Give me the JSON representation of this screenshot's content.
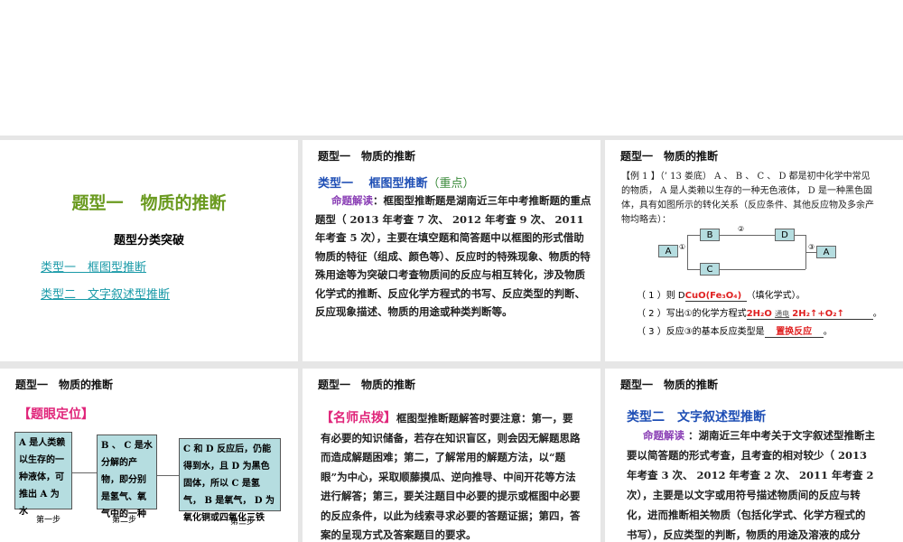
{
  "header": "题型一　物质的推断",
  "slide1": {
    "title": "题型一　物质的推断",
    "subtitle": "题型分类突破",
    "links": [
      "类型一　框图型推断",
      "类型二　文字叙述型推断"
    ]
  },
  "slide2": {
    "type_label": "类型一　 框图型推断",
    "emphasis": "（重点）",
    "lead": "命题解读",
    "text": "：框图型推断题是湖南近三年中考推断题的重点题型（ 2013 年考查 7 次、 2012 年考查 9 次、 2011 年考查 5 次），主要在填空题和简答题中以框图的形式借助物质的特征（组成、颜色等）、反应时的特殊现象、物质的特殊用途等为突破口考查物质间的反应与相互转化，涉及物质化学式的推断、反应化学方程式的书写、反应类型的判断、反应现象描述、物质的用途或种类判断等。"
  },
  "slide3": {
    "example": "【例 1 】（’ 13 娄底） A 、 B 、 C 、 D 都是初中化学中常见的物质， A 是人类赖以生存的一种无色液体， D 是一种黑色固体，具有如图所示的转化关系（反应条件、其他反应物及多余产物均略去）：",
    "nodes": [
      "A",
      "B",
      "C",
      "D",
      "A"
    ],
    "marks": [
      "①",
      "②",
      "③"
    ],
    "q1_pre": "（ 1 ）则 D",
    "q1_ans": "CuO(Fe₃O₄)",
    "q1_post": "（填化学式）。",
    "q2_pre": "（ 2 ）写出①的化学方程式",
    "q2_lhs": "2H₂O",
    "q2_cond": "通电",
    "q2_rhs": "2H₂↑+O₂↑",
    "q2_post": "。",
    "q3_pre": "（ 3 ）反应③的基本反应类型是",
    "q3_ans": "置换反应",
    "q3_post": "。"
  },
  "slide4": {
    "label": "【题眼定位】",
    "steps": [
      {
        "text": "A 是人类赖以生存的一种液体，可推出 A 为水",
        "caption": "第一步"
      },
      {
        "text": "B 、 C 是水分解的产物，即分别是氢气、氧气中的一种",
        "caption": "第二步"
      },
      {
        "text": "C 和 D 反应后，仍能得到水，且 D 为黑色固体，所以 C 是氢气， B 是氧气， D 为氧化铜或四氧化三铁",
        "caption": "第三步"
      }
    ]
  },
  "slide5": {
    "label": "【名师点拨】",
    "text": "框图型推断题解答时要注意：第一，要有必要的知识储备，若存在知识盲区，则会因无解题思路而造成解题困难；第二，了解常用的解题方法，以“题眼”为中心，采取顺藤摸瓜、逆向推导、中间开花等方法进行解答；第三，要关注题目中必要的提示或框图中必要的反应条件，以此为线索寻求必要的答题证据；第四，答案的呈现方式及答案题目的要求。"
  },
  "slide6": {
    "type_label": "类型二　文字叙述型推断",
    "lead": "命题解读",
    "text": " ：湖南近三年中考关于文字叙述型推断主要以简答题的形式考查，且考查的相对较少（ 2013 年考查 3 次、 2012 年考查 2 次、 2011 年考查 2 次），主要是以文字或用符号描述物质间的反应与转化，进而推断相关物质（包括化学式、化学方程式的书写），反应类型的判断，物质的用途及溶液的成分等。"
  }
}
